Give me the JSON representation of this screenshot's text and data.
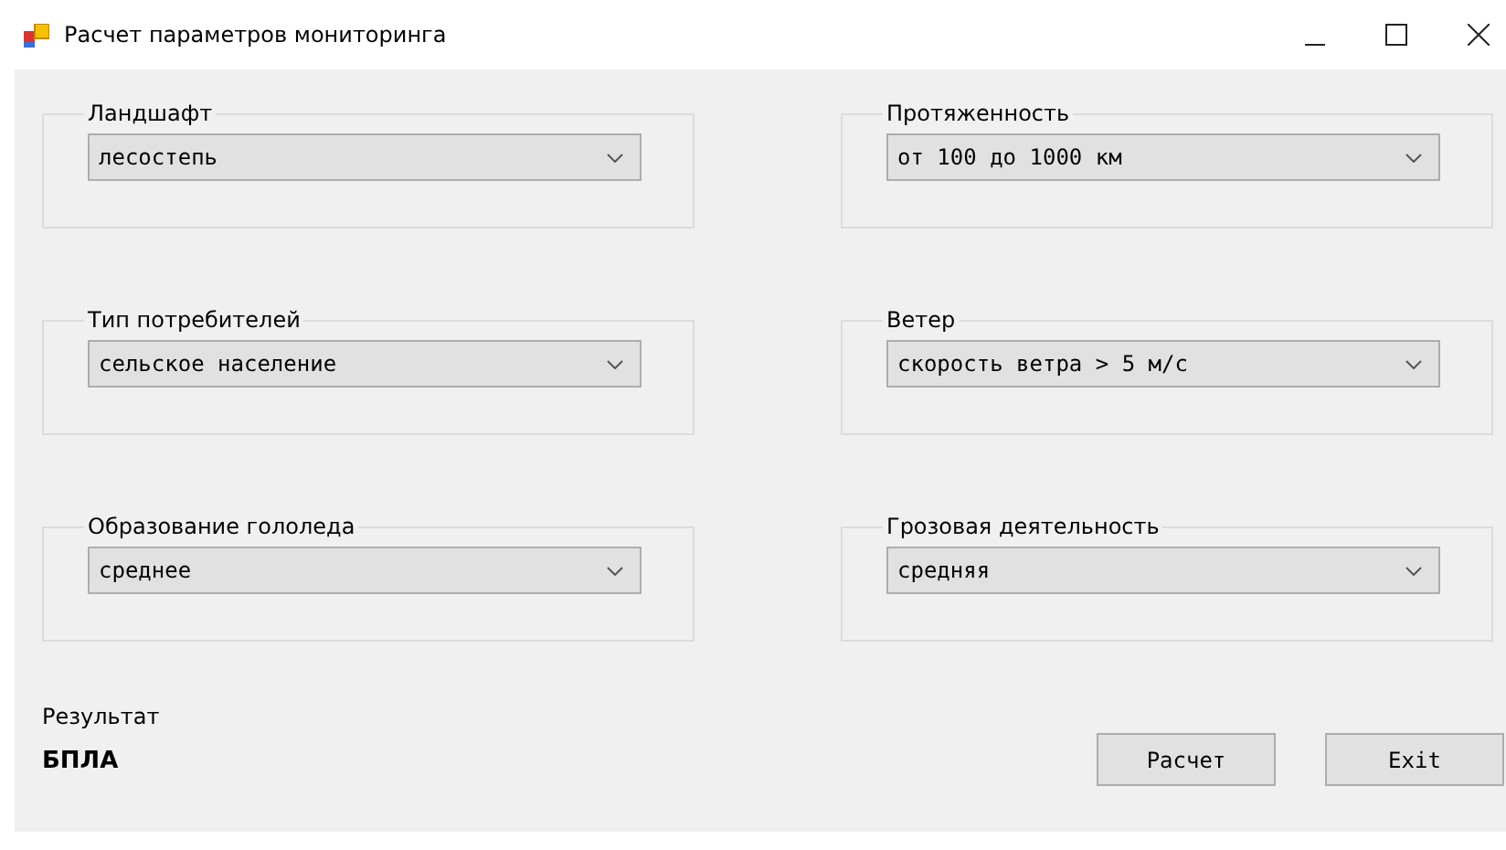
{
  "window": {
    "title": "Расчет параметров мониторинга"
  },
  "groups": [
    {
      "label": "Ландшафт",
      "value": "лесостепь"
    },
    {
      "label": "Протяженность",
      "value": "от 100 до 1000 км"
    },
    {
      "label": "Тип  потребителей",
      "value": "сельское  население"
    },
    {
      "label": "Ветер",
      "value": "скорость ветра > 5 м/с"
    },
    {
      "label": "Образование  гололеда",
      "value": "среднее"
    },
    {
      "label": "Грозовая  деятельность",
      "value": "средняя"
    }
  ],
  "result": {
    "label": "Результат",
    "value": "БПЛА"
  },
  "buttons": [
    "Расчет",
    "Exit"
  ]
}
